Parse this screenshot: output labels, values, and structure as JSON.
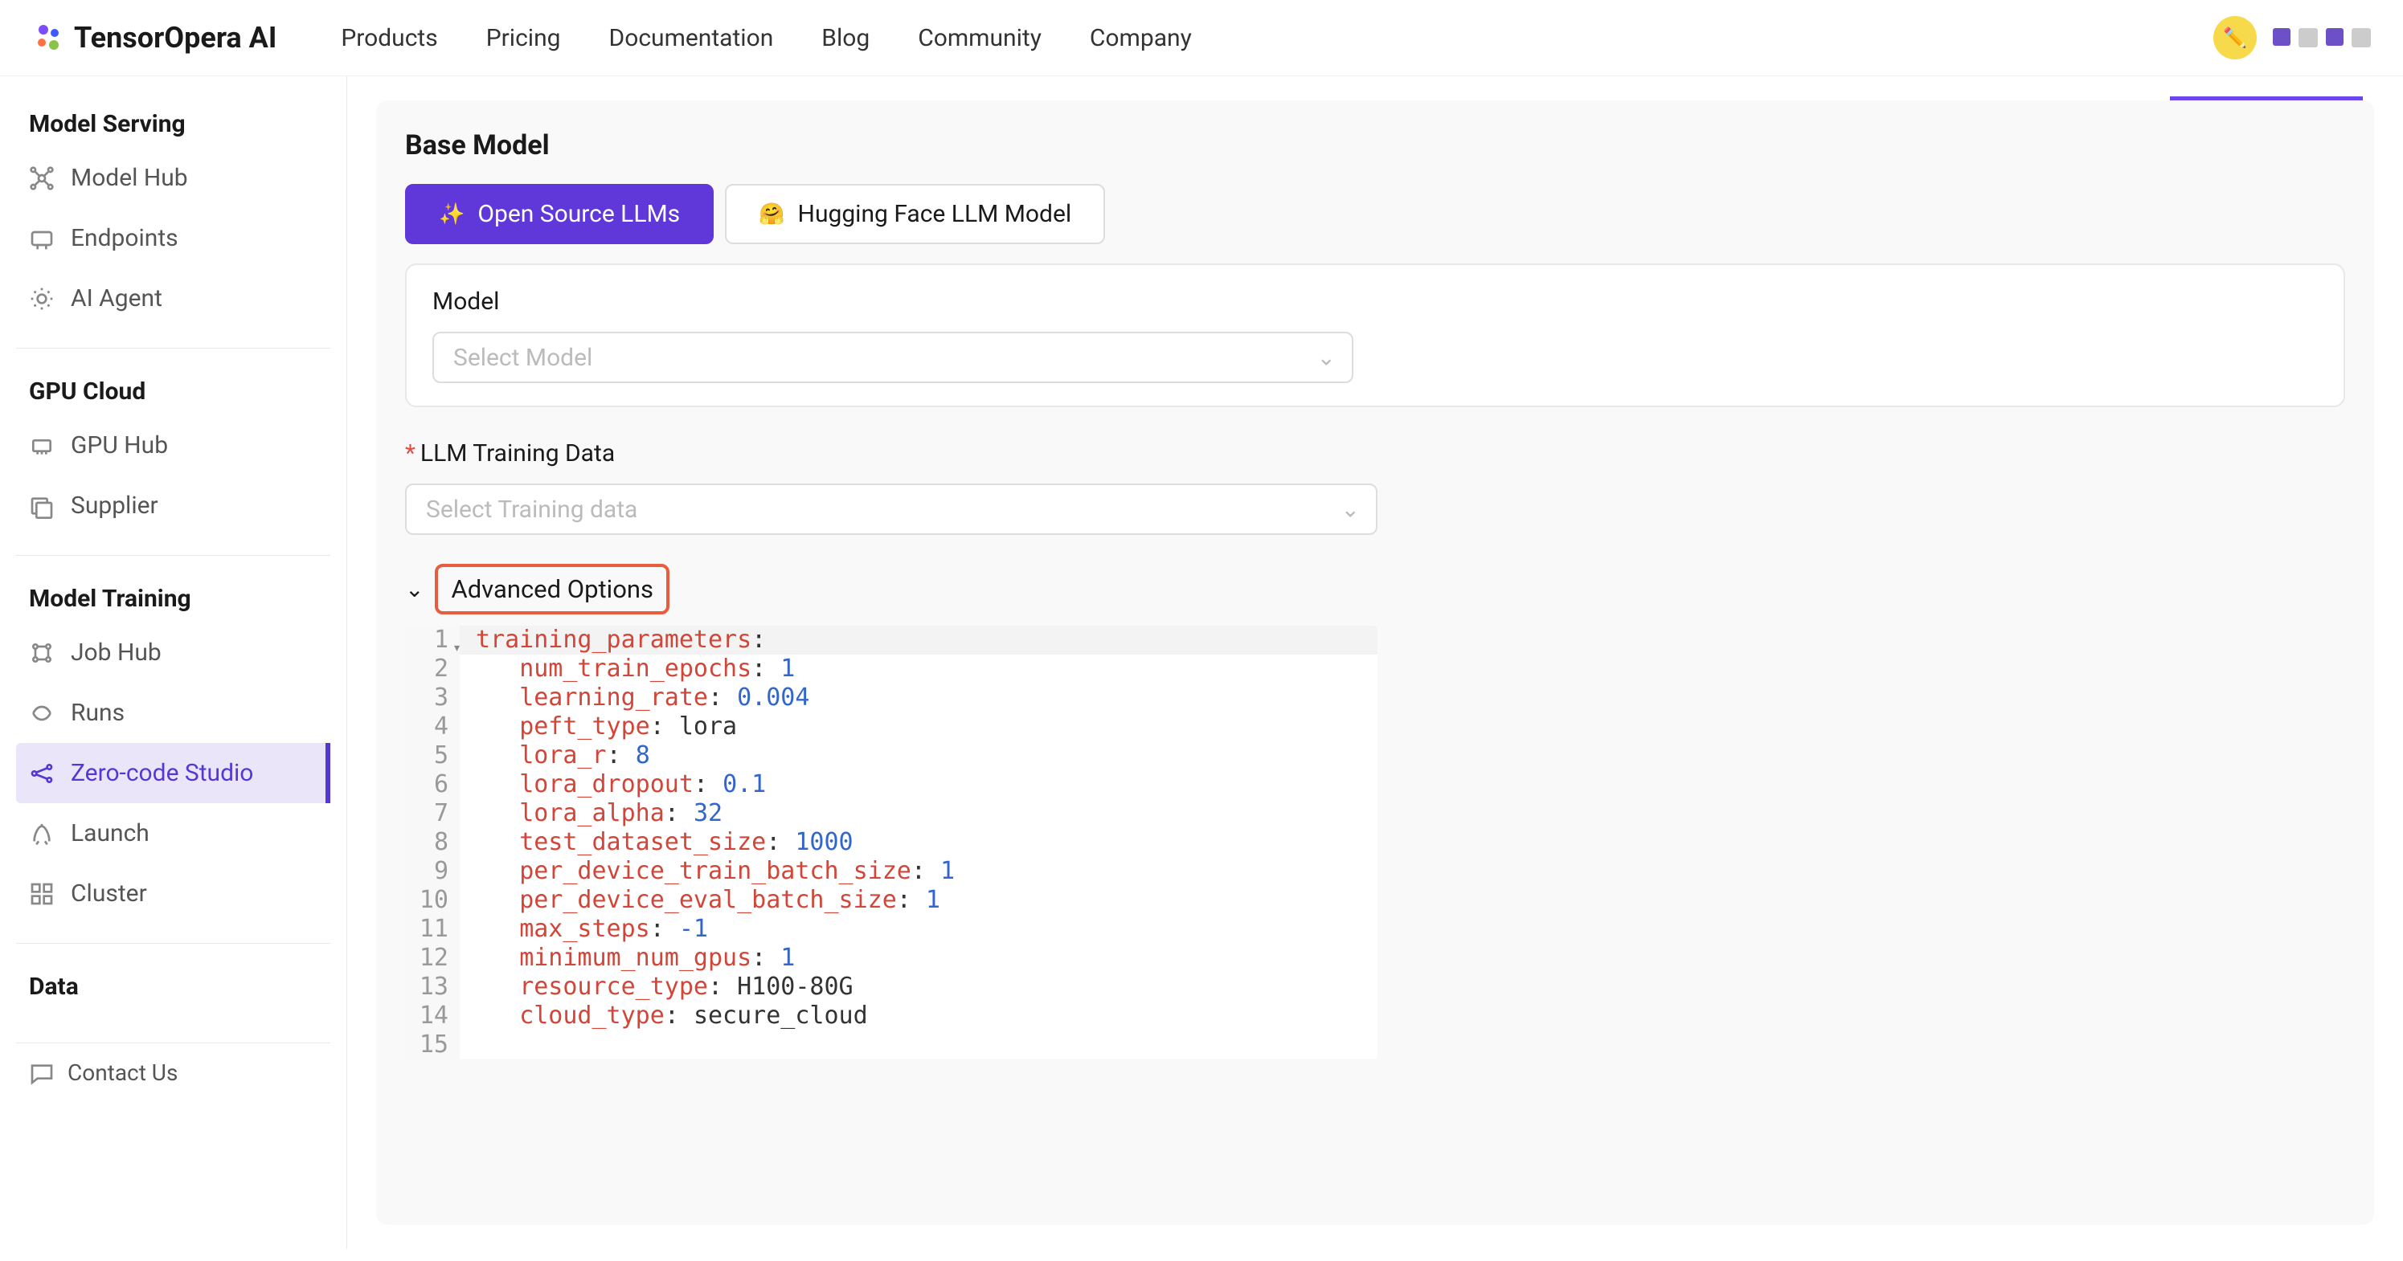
{
  "brand": "TensorOpera AI",
  "nav": [
    "Products",
    "Pricing",
    "Documentation",
    "Blog",
    "Community",
    "Company"
  ],
  "sidebar": {
    "sections": [
      {
        "title": "Model Serving",
        "items": [
          {
            "label": "Model Hub",
            "icon": "hub"
          },
          {
            "label": "Endpoints",
            "icon": "endpoints"
          },
          {
            "label": "AI Agent",
            "icon": "agent"
          }
        ]
      },
      {
        "title": "GPU Cloud",
        "items": [
          {
            "label": "GPU Hub",
            "icon": "gpu"
          },
          {
            "label": "Supplier",
            "icon": "supplier"
          }
        ]
      },
      {
        "title": "Model Training",
        "items": [
          {
            "label": "Job Hub",
            "icon": "job"
          },
          {
            "label": "Runs",
            "icon": "runs"
          },
          {
            "label": "Zero-code Studio",
            "icon": "studio",
            "active": true
          },
          {
            "label": "Launch",
            "icon": "launch"
          },
          {
            "label": "Cluster",
            "icon": "cluster"
          }
        ]
      },
      {
        "title": "Data",
        "items": []
      }
    ],
    "contact": "Contact Us"
  },
  "main": {
    "heading": "Base Model",
    "tabs": [
      {
        "label": "Open Source LLMs",
        "active": true
      },
      {
        "label": "Hugging Face LLM Model",
        "active": false
      }
    ],
    "model_label": "Model",
    "model_placeholder": "Select Model",
    "data_label": "LLM Training Data",
    "data_placeholder": "Select Training data",
    "advanced_label": "Advanced Options",
    "code": [
      {
        "n": 1,
        "key": "training_parameters",
        "sep": ":",
        "val": "",
        "indent": 0,
        "fold": true
      },
      {
        "n": 2,
        "key": "num_train_epochs",
        "sep": ": ",
        "val": "1",
        "vtype": "n",
        "indent": 1
      },
      {
        "n": 3,
        "key": "learning_rate",
        "sep": ": ",
        "val": "0.004",
        "vtype": "n",
        "indent": 1
      },
      {
        "n": 4,
        "key": "peft_type",
        "sep": ": ",
        "val": "lora",
        "vtype": "v",
        "indent": 1
      },
      {
        "n": 5,
        "key": "lora_r",
        "sep": ": ",
        "val": "8",
        "vtype": "n",
        "indent": 1
      },
      {
        "n": 6,
        "key": "lora_dropout",
        "sep": ": ",
        "val": "0.1",
        "vtype": "n",
        "indent": 1
      },
      {
        "n": 7,
        "key": "lora_alpha",
        "sep": ": ",
        "val": "32",
        "vtype": "n",
        "indent": 1
      },
      {
        "n": 8,
        "key": "test_dataset_size",
        "sep": ": ",
        "val": "1000",
        "vtype": "n",
        "indent": 1
      },
      {
        "n": 9,
        "key": "per_device_train_batch_size",
        "sep": ": ",
        "val": "1",
        "vtype": "n",
        "indent": 1
      },
      {
        "n": 10,
        "key": "per_device_eval_batch_size",
        "sep": ": ",
        "val": "1",
        "vtype": "n",
        "indent": 1
      },
      {
        "n": 11,
        "key": "max_steps",
        "sep": ": ",
        "val": "-1",
        "vtype": "n",
        "indent": 1
      },
      {
        "n": 12,
        "key": "minimum_num_gpus",
        "sep": ": ",
        "val": "1",
        "vtype": "n",
        "indent": 1
      },
      {
        "n": 13,
        "key": "resource_type",
        "sep": ": ",
        "val": "H100-80G",
        "vtype": "v",
        "indent": 1
      },
      {
        "n": 14,
        "key": "cloud_type",
        "sep": ": ",
        "val": "secure_cloud",
        "vtype": "v",
        "indent": 1
      },
      {
        "n": 15,
        "key": "",
        "sep": "",
        "val": "",
        "indent": 0
      }
    ]
  }
}
